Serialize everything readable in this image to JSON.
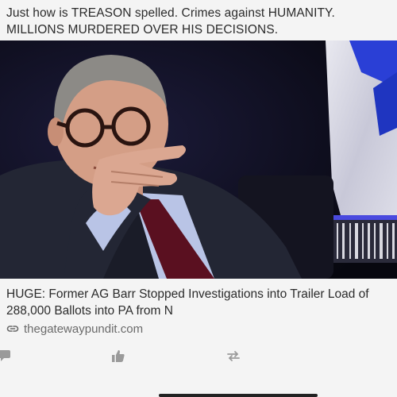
{
  "post": {
    "text": "Just how is TREASON spelled. Crimes against HUMANITY.  MILLIONS MURDERED OVER HIS DECISIONS."
  },
  "card": {
    "title": "HUGE: Former AG Barr Stopped Investigations into Trailer Load of 288,000 Ballots into PA from N",
    "domain": "thegatewaypundit.com",
    "link_icon": "link-icon"
  },
  "actions": {
    "icons": [
      "comment-icon",
      "like-icon",
      "retweet-icon"
    ]
  },
  "colors": {
    "text": "#2b2b2b",
    "muted": "#6a6a6a",
    "background": "#f4f4f4",
    "icon": "#9a9a9a"
  }
}
